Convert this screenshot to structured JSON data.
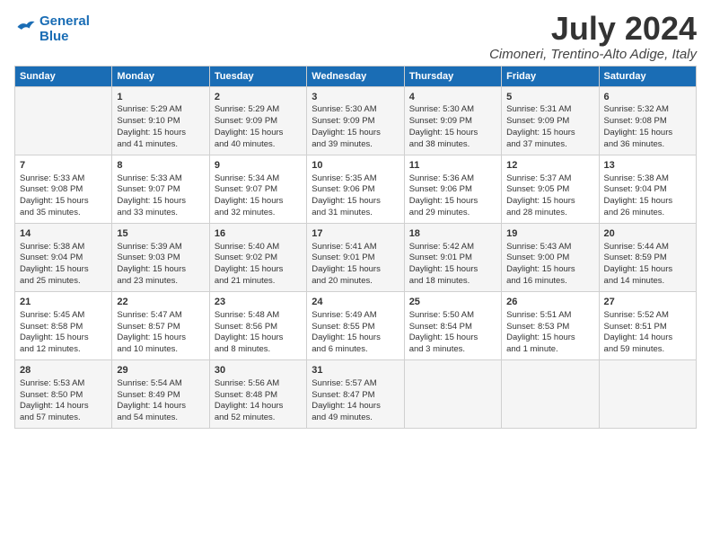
{
  "logo": {
    "line1": "General",
    "line2": "Blue"
  },
  "title": "July 2024",
  "subtitle": "Cimoneri, Trentino-Alto Adige, Italy",
  "weekdays": [
    "Sunday",
    "Monday",
    "Tuesday",
    "Wednesday",
    "Thursday",
    "Friday",
    "Saturday"
  ],
  "weeks": [
    [
      {
        "day": "",
        "info": ""
      },
      {
        "day": "1",
        "info": "Sunrise: 5:29 AM\nSunset: 9:10 PM\nDaylight: 15 hours\nand 41 minutes."
      },
      {
        "day": "2",
        "info": "Sunrise: 5:29 AM\nSunset: 9:09 PM\nDaylight: 15 hours\nand 40 minutes."
      },
      {
        "day": "3",
        "info": "Sunrise: 5:30 AM\nSunset: 9:09 PM\nDaylight: 15 hours\nand 39 minutes."
      },
      {
        "day": "4",
        "info": "Sunrise: 5:30 AM\nSunset: 9:09 PM\nDaylight: 15 hours\nand 38 minutes."
      },
      {
        "day": "5",
        "info": "Sunrise: 5:31 AM\nSunset: 9:09 PM\nDaylight: 15 hours\nand 37 minutes."
      },
      {
        "day": "6",
        "info": "Sunrise: 5:32 AM\nSunset: 9:08 PM\nDaylight: 15 hours\nand 36 minutes."
      }
    ],
    [
      {
        "day": "7",
        "info": "Sunrise: 5:33 AM\nSunset: 9:08 PM\nDaylight: 15 hours\nand 35 minutes."
      },
      {
        "day": "8",
        "info": "Sunrise: 5:33 AM\nSunset: 9:07 PM\nDaylight: 15 hours\nand 33 minutes."
      },
      {
        "day": "9",
        "info": "Sunrise: 5:34 AM\nSunset: 9:07 PM\nDaylight: 15 hours\nand 32 minutes."
      },
      {
        "day": "10",
        "info": "Sunrise: 5:35 AM\nSunset: 9:06 PM\nDaylight: 15 hours\nand 31 minutes."
      },
      {
        "day": "11",
        "info": "Sunrise: 5:36 AM\nSunset: 9:06 PM\nDaylight: 15 hours\nand 29 minutes."
      },
      {
        "day": "12",
        "info": "Sunrise: 5:37 AM\nSunset: 9:05 PM\nDaylight: 15 hours\nand 28 minutes."
      },
      {
        "day": "13",
        "info": "Sunrise: 5:38 AM\nSunset: 9:04 PM\nDaylight: 15 hours\nand 26 minutes."
      }
    ],
    [
      {
        "day": "14",
        "info": "Sunrise: 5:38 AM\nSunset: 9:04 PM\nDaylight: 15 hours\nand 25 minutes."
      },
      {
        "day": "15",
        "info": "Sunrise: 5:39 AM\nSunset: 9:03 PM\nDaylight: 15 hours\nand 23 minutes."
      },
      {
        "day": "16",
        "info": "Sunrise: 5:40 AM\nSunset: 9:02 PM\nDaylight: 15 hours\nand 21 minutes."
      },
      {
        "day": "17",
        "info": "Sunrise: 5:41 AM\nSunset: 9:01 PM\nDaylight: 15 hours\nand 20 minutes."
      },
      {
        "day": "18",
        "info": "Sunrise: 5:42 AM\nSunset: 9:01 PM\nDaylight: 15 hours\nand 18 minutes."
      },
      {
        "day": "19",
        "info": "Sunrise: 5:43 AM\nSunset: 9:00 PM\nDaylight: 15 hours\nand 16 minutes."
      },
      {
        "day": "20",
        "info": "Sunrise: 5:44 AM\nSunset: 8:59 PM\nDaylight: 15 hours\nand 14 minutes."
      }
    ],
    [
      {
        "day": "21",
        "info": "Sunrise: 5:45 AM\nSunset: 8:58 PM\nDaylight: 15 hours\nand 12 minutes."
      },
      {
        "day": "22",
        "info": "Sunrise: 5:47 AM\nSunset: 8:57 PM\nDaylight: 15 hours\nand 10 minutes."
      },
      {
        "day": "23",
        "info": "Sunrise: 5:48 AM\nSunset: 8:56 PM\nDaylight: 15 hours\nand 8 minutes."
      },
      {
        "day": "24",
        "info": "Sunrise: 5:49 AM\nSunset: 8:55 PM\nDaylight: 15 hours\nand 6 minutes."
      },
      {
        "day": "25",
        "info": "Sunrise: 5:50 AM\nSunset: 8:54 PM\nDaylight: 15 hours\nand 3 minutes."
      },
      {
        "day": "26",
        "info": "Sunrise: 5:51 AM\nSunset: 8:53 PM\nDaylight: 15 hours\nand 1 minute."
      },
      {
        "day": "27",
        "info": "Sunrise: 5:52 AM\nSunset: 8:51 PM\nDaylight: 14 hours\nand 59 minutes."
      }
    ],
    [
      {
        "day": "28",
        "info": "Sunrise: 5:53 AM\nSunset: 8:50 PM\nDaylight: 14 hours\nand 57 minutes."
      },
      {
        "day": "29",
        "info": "Sunrise: 5:54 AM\nSunset: 8:49 PM\nDaylight: 14 hours\nand 54 minutes."
      },
      {
        "day": "30",
        "info": "Sunrise: 5:56 AM\nSunset: 8:48 PM\nDaylight: 14 hours\nand 52 minutes."
      },
      {
        "day": "31",
        "info": "Sunrise: 5:57 AM\nSunset: 8:47 PM\nDaylight: 14 hours\nand 49 minutes."
      },
      {
        "day": "",
        "info": ""
      },
      {
        "day": "",
        "info": ""
      },
      {
        "day": "",
        "info": ""
      }
    ]
  ]
}
